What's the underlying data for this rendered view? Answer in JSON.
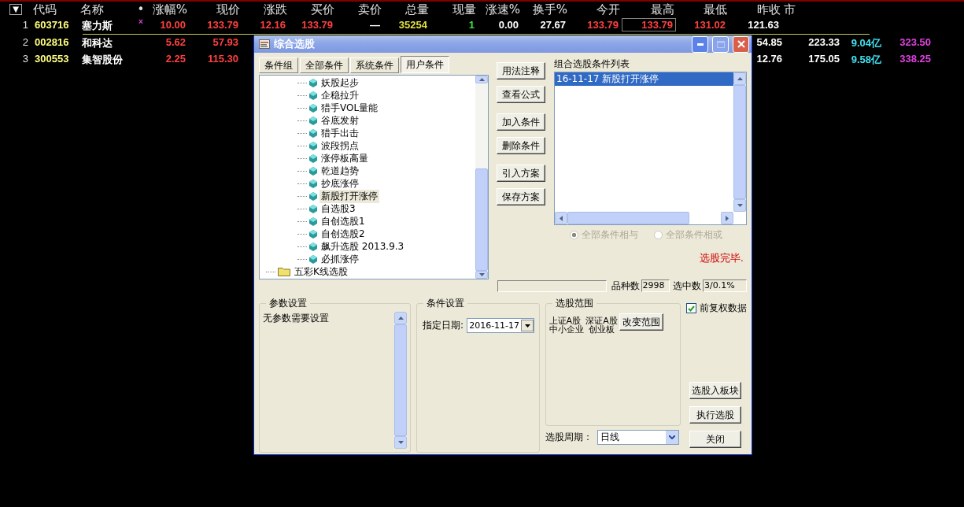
{
  "table": {
    "sort_menu": "▼",
    "columns": [
      "代码",
      "名称",
      "•",
      "涨幅%",
      "现价",
      "涨跌",
      "买价",
      "卖价",
      "总量",
      "现量",
      "涨速%",
      "换手%",
      "今开",
      "最高",
      "最低",
      "昨收",
      "市"
    ],
    "rows": [
      {
        "selected": true,
        "index": "1",
        "cells": [
          {
            "text": "603716",
            "color": "#ffff80"
          },
          {
            "text": "塞力斯",
            "color": "#ffffff"
          },
          {
            "text": "×",
            "color": "#e040e0"
          },
          {
            "text": "10.00",
            "color": "#ff4040"
          },
          {
            "text": "133.79",
            "color": "#ff4040"
          },
          {
            "text": "12.16",
            "color": "#ff4040"
          },
          {
            "text": "133.79",
            "color": "#ff4040"
          },
          {
            "text": "—",
            "color": "#ffffff"
          },
          {
            "text": "35254",
            "color": "#e0e040"
          },
          {
            "text": "1",
            "color": "#40e040"
          },
          {
            "text": "0.00",
            "color": "#ffffff"
          },
          {
            "text": "27.67",
            "color": "#ffffff"
          },
          {
            "text": "133.79",
            "color": "#ff4040"
          },
          {
            "text": "133.79",
            "color": "#ff4040",
            "focused": true
          },
          {
            "text": "131.02",
            "color": "#ff4040"
          },
          {
            "text": "121.63",
            "color": "#ffffff"
          }
        ]
      },
      {
        "selected": false,
        "index": "2",
        "cells": [
          {
            "text": "002816",
            "color": "#ffff80"
          },
          {
            "text": "和科达",
            "color": "#ffffff"
          },
          {
            "text": ""
          },
          {
            "text": "5.62",
            "color": "#ff4040"
          },
          {
            "text": "57.93",
            "color": "#ff4040"
          }
        ],
        "trailing": [
          {
            "text": "54.85",
            "color": "#ffffff"
          },
          {
            "text": "223.33",
            "color": "#ffffff"
          },
          {
            "text": "9.04亿",
            "color": "#40e0f0"
          },
          {
            "text": "323.50",
            "color": "#e040e0"
          }
        ]
      },
      {
        "selected": false,
        "index": "3",
        "cells": [
          {
            "text": "300553",
            "color": "#ffff80"
          },
          {
            "text": "集智股份",
            "color": "#ffffff"
          },
          {
            "text": ""
          },
          {
            "text": "2.25",
            "color": "#ff4040"
          },
          {
            "text": "115.30",
            "color": "#ff4040"
          }
        ],
        "trailing": [
          {
            "text": "12.76",
            "color": "#ffffff"
          },
          {
            "text": "175.05",
            "color": "#ffffff"
          },
          {
            "text": "9.58亿",
            "color": "#40e0f0"
          },
          {
            "text": "338.25",
            "color": "#e040e0"
          }
        ]
      }
    ]
  },
  "dialog": {
    "title": "综合选股",
    "tabs": [
      {
        "label": "条件组",
        "selected": false
      },
      {
        "label": "全部条件",
        "selected": false
      },
      {
        "label": "系统条件",
        "selected": false
      },
      {
        "label": "用户条件",
        "selected": true
      }
    ],
    "tree": [
      {
        "kind": "group",
        "children": [
          {
            "label": "妖股起步",
            "selected": false
          },
          {
            "label": "企稳拉升",
            "selected": false
          },
          {
            "label": "猎手VOL量能",
            "selected": false
          },
          {
            "label": "谷底发射",
            "selected": false
          },
          {
            "label": "猎手出击",
            "selected": false
          },
          {
            "label": "波段拐点",
            "selected": false
          },
          {
            "label": "涨停板高量",
            "selected": false
          },
          {
            "label": "乾道趋势",
            "selected": false
          },
          {
            "label": "抄底涨停",
            "selected": false
          },
          {
            "label": "新股打开涨停",
            "selected": true
          },
          {
            "label": "自选股3",
            "selected": false
          },
          {
            "label": "自创选股1",
            "selected": false
          },
          {
            "label": "自创选股2",
            "selected": false
          },
          {
            "label": "飙升选股 2013.9.3",
            "selected": false
          },
          {
            "label": "必抓涨停",
            "selected": false
          }
        ]
      },
      {
        "kind": "folder",
        "label": "五彩K线选股"
      }
    ],
    "action_buttons": [
      [
        "用法注释",
        "查看公式"
      ],
      [
        "加入条件",
        "删除条件"
      ],
      [
        "引入方案",
        "保存方案"
      ]
    ],
    "list_title": "组合选股条件列表",
    "list_items": [
      {
        "text": "16-11-17 新股打开涨停",
        "selected": true
      }
    ],
    "logic": {
      "disabled": true,
      "options": [
        {
          "label": "全部条件相与",
          "selected": true
        },
        {
          "label": "全部条件相或",
          "selected": false
        }
      ]
    },
    "status": "选股完毕.",
    "progress": {
      "level": 0
    },
    "total_label": "品种数",
    "total": "2998",
    "picked_label": "选中数",
    "picked": "3/0.1%",
    "params": {
      "title": "参数设置",
      "text": "无参数需要设置"
    },
    "condition": {
      "title": "条件设置",
      "date_label": "指定日期:",
      "date": "2016-11-17"
    },
    "scope": {
      "title": "选股范围",
      "markets": [
        [
          "上证A股",
          "深证A股"
        ],
        [
          "中小企业",
          "创业板"
        ]
      ],
      "button": "改变范围"
    },
    "adjust": {
      "label": "前复权数据",
      "checked": true
    },
    "period": {
      "label": "选股周期：",
      "value": "日线"
    },
    "side_buttons": [
      "选股入板块",
      "执行选股"
    ],
    "close": "关闭"
  }
}
